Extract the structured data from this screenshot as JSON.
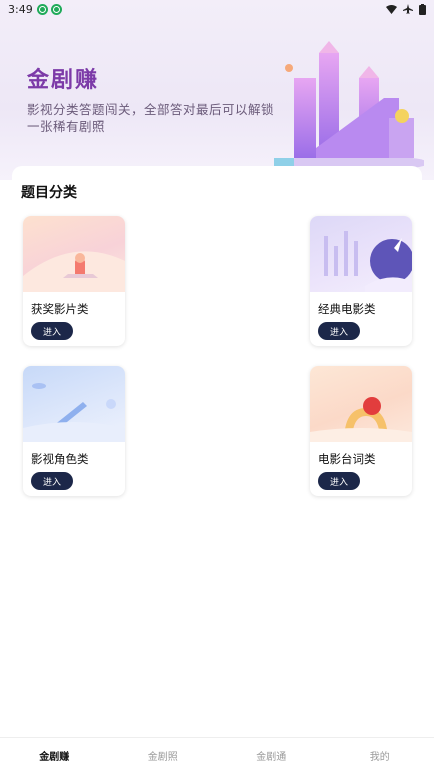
{
  "status": {
    "time": "3:49"
  },
  "hero": {
    "title": "金剧赚",
    "desc": "影视分类答题闯关，全部答对最后可以解锁一张稀有剧照"
  },
  "section": {
    "title": "题目分类"
  },
  "categories": [
    {
      "label": "获奖影片类",
      "button": "进入"
    },
    {
      "label": "经典电影类",
      "button": "进入"
    },
    {
      "label": "影视角色类",
      "button": "进入"
    },
    {
      "label": "电影台词类",
      "button": "进入"
    }
  ],
  "tabs": [
    {
      "label": "金剧赚"
    },
    {
      "label": "金剧照"
    },
    {
      "label": "金剧通"
    },
    {
      "label": "我的"
    }
  ],
  "colors": {
    "accent": "#7c3aa8",
    "button": "#1c2749"
  }
}
